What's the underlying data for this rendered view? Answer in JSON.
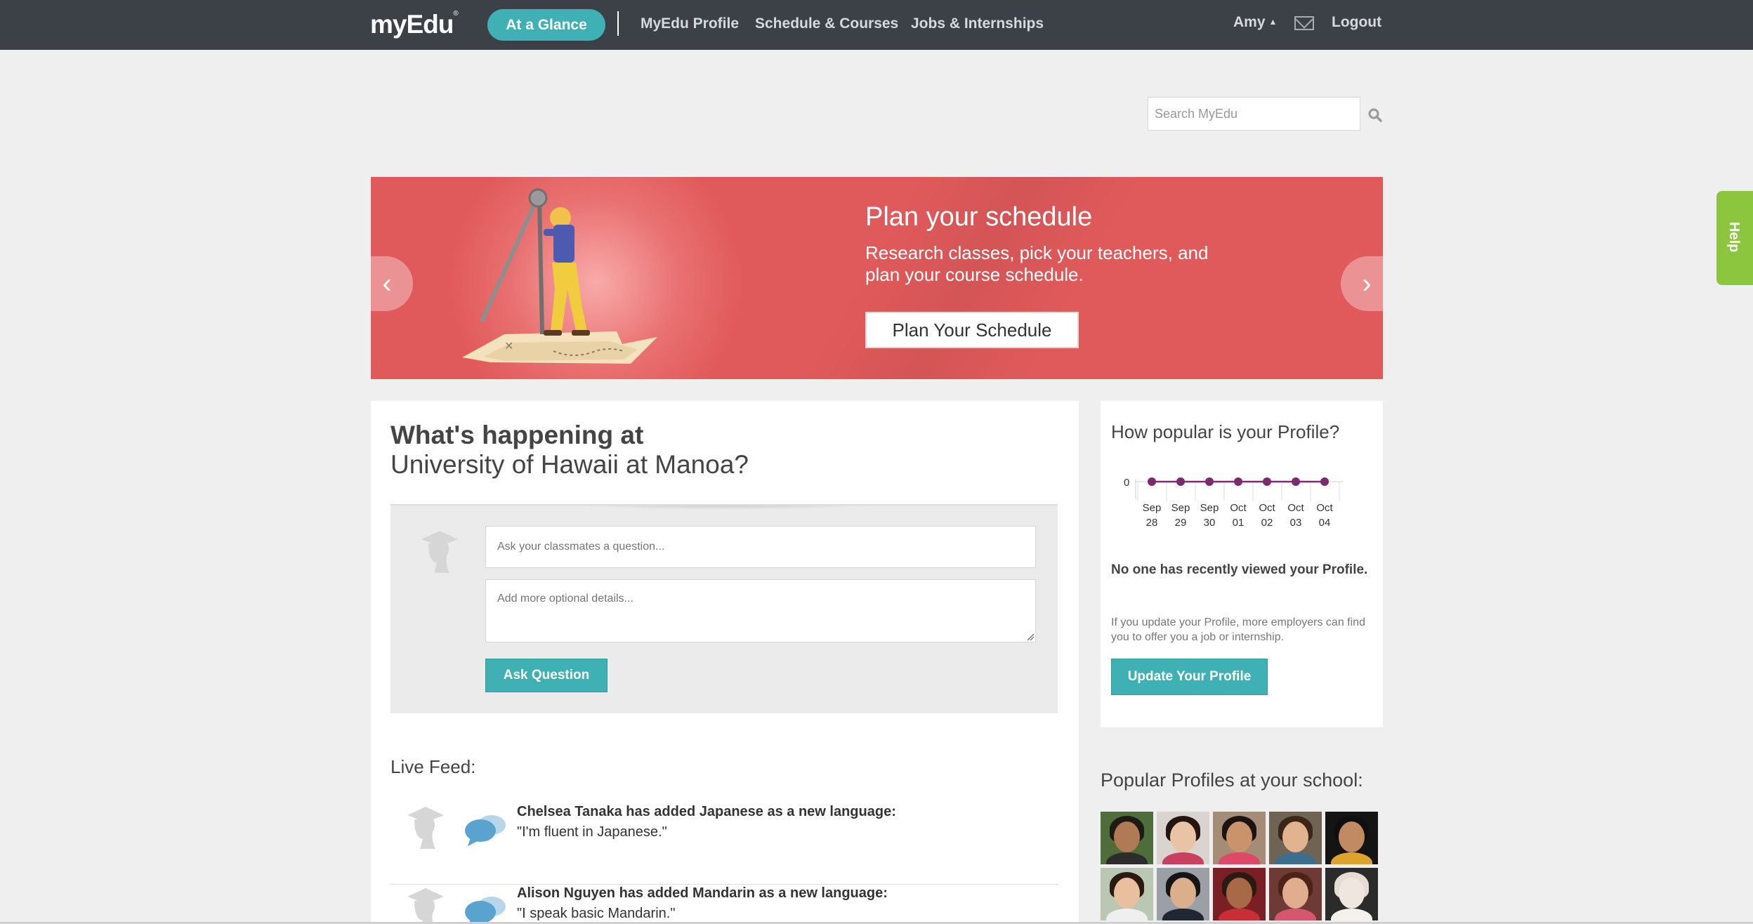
{
  "nav": {
    "logo": "myEdu",
    "logo_mark": "®",
    "at_a_glance": "At a Glance",
    "links": [
      "MyEdu Profile",
      "Schedule & Courses",
      "Jobs & Internships"
    ],
    "user": "Amy",
    "user_caret": "▲",
    "logout": "Logout"
  },
  "search": {
    "placeholder": "Search MyEdu"
  },
  "banner": {
    "title": "Plan your schedule",
    "subtitle": "Research classes, pick your teachers, and plan your course schedule.",
    "button": "Plan Your Schedule",
    "prev": "‹",
    "next": "›",
    "color": "#e15a5b"
  },
  "help_tab": "Help",
  "main": {
    "title": "What's happening at",
    "school": "University of Hawaii at Manoa?",
    "ask_placeholder": "Ask your classmates a question...",
    "details_placeholder": "Add more optional details...",
    "ask_button": "Ask Question",
    "live_feed_title": "Live Feed:",
    "feed": [
      {
        "headline": "Chelsea Tanaka has added Japanese as a new language:",
        "quote": "\"I'm fluent in Japanese.\""
      },
      {
        "headline": "Alison Nguyen has added Mandarin as a new language:",
        "quote": "\"I speak basic Mandarin.\""
      }
    ]
  },
  "popularity": {
    "title": "How popular is your Profile?",
    "nobody": "No one has recently viewed your Profile.",
    "note": "If you update your Profile, more employers can find you to offer you a job or internship.",
    "button": "Update Your Profile"
  },
  "chart_data": {
    "type": "line",
    "categories": [
      "Sep 28",
      "Sep 29",
      "Sep 30",
      "Oct 01",
      "Oct 02",
      "Oct 03",
      "Oct 04"
    ],
    "tick_labels": [
      [
        "Sep",
        "28"
      ],
      [
        "Sep",
        "29"
      ],
      [
        "Sep",
        "30"
      ],
      [
        "Oct",
        "01"
      ],
      [
        "Oct",
        "02"
      ],
      [
        "Oct",
        "03"
      ],
      [
        "Oct",
        "04"
      ]
    ],
    "values": [
      0,
      0,
      0,
      0,
      0,
      0,
      0
    ],
    "y_tick": "0",
    "line_color": "#7b2a6e"
  },
  "popular_profiles": {
    "title": "Popular Profiles at your school:",
    "photos": [
      {
        "bg": "#4f6d3a",
        "skin": "#b07a55",
        "hair": "#1e1a16",
        "shirt": "#2c2c2c"
      },
      {
        "bg": "#d9d4d0",
        "skin": "#e8c3a6",
        "hair": "#24160f",
        "shirt": "#c7405e"
      },
      {
        "bg": "#a58c76",
        "skin": "#c9936b",
        "hair": "#1d1412",
        "shirt": "#dd4a68"
      },
      {
        "bg": "#6f6354",
        "skin": "#e1b38e",
        "hair": "#3b2618",
        "shirt": "#3d6e8f"
      },
      {
        "bg": "#141414",
        "skin": "#c08a62",
        "hair": "#0f0f0f",
        "shirt": "#e0a22e"
      },
      {
        "bg": "#b9c7b3",
        "skin": "#e9c09f",
        "hair": "#2a1a12",
        "shirt": "#efefef"
      },
      {
        "bg": "#9aa0a6",
        "skin": "#d9b08b",
        "hair": "#151515",
        "shirt": "#1f2733"
      },
      {
        "bg": "#7a1f24",
        "skin": "#a86a46",
        "hair": "#2a1b12",
        "shirt": "#c62f37"
      },
      {
        "bg": "#6e3a35",
        "skin": "#e2ac8f",
        "hair": "#4a2417",
        "shirt": "#d4566f"
      },
      {
        "bg": "#2b2b2b",
        "skin": "#efe7df",
        "hair": "#e5dcd2",
        "shirt": "#f4f0eb"
      }
    ]
  }
}
